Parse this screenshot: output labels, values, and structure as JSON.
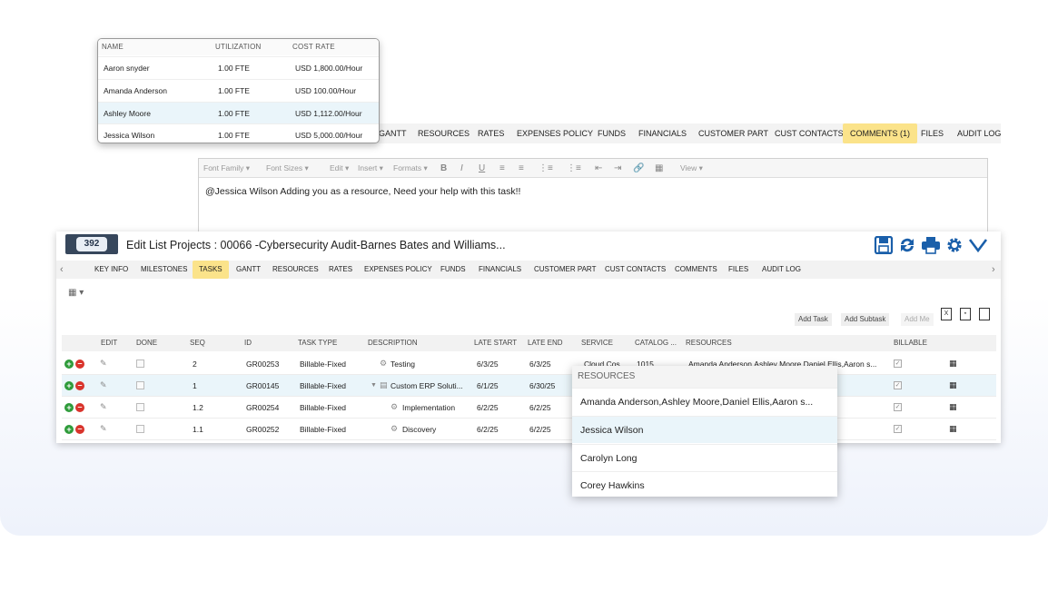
{
  "back_window": {
    "tabs": [
      {
        "label": "GANTT"
      },
      {
        "label": "RESOURCES"
      },
      {
        "label": "RATES"
      },
      {
        "label": "EXPENSES POLICY"
      },
      {
        "label": "FUNDS"
      },
      {
        "label": "FINANCIALS"
      },
      {
        "label": "CUSTOMER PART"
      },
      {
        "label": "CUST CONTACTS"
      },
      {
        "label": "COMMENTS (1)"
      },
      {
        "label": "FILES"
      },
      {
        "label": "AUDIT LOG"
      }
    ],
    "active_tab": "COMMENTS (1)",
    "editor": {
      "toolbar": {
        "font_family": "Font Family",
        "font_sizes": "Font Sizes",
        "edit": "Edit",
        "insert": "Insert",
        "formats": "Formats",
        "view": "View"
      },
      "content": "@Jessica Wilson Adding you as a resource, Need your help with this task!!"
    }
  },
  "rates_popup": {
    "headers": {
      "name": "NAME",
      "utilization": "UTILIZATION",
      "cost_rate": "COST RATE"
    },
    "rows": [
      {
        "name": "Aaron snyder",
        "utilization": "1.00 FTE",
        "cost_rate": "USD 1,800.00/Hour"
      },
      {
        "name": "Amanda Anderson",
        "utilization": "1.00 FTE",
        "cost_rate": "USD 100.00/Hour"
      },
      {
        "name": "Ashley Moore",
        "utilization": "1.00 FTE",
        "cost_rate": "USD 1,112.00/Hour"
      },
      {
        "name": "Jessica Wilson",
        "utilization": "1.00 FTE",
        "cost_rate": "USD 5,000.00/Hour"
      }
    ]
  },
  "main_window": {
    "logo_text": "392",
    "title": "Edit List Projects : 00066 -Cybersecurity Audit-Barnes Bates and Williams...",
    "tabs": [
      {
        "label": "KEY INFO"
      },
      {
        "label": "MILESTONES"
      },
      {
        "label": "TASKS"
      },
      {
        "label": "GANTT"
      },
      {
        "label": "RESOURCES"
      },
      {
        "label": "RATES"
      },
      {
        "label": "EXPENSES POLICY"
      },
      {
        "label": "FUNDS"
      },
      {
        "label": "FINANCIALS"
      },
      {
        "label": "CUSTOMER PART"
      },
      {
        "label": "CUST CONTACTS"
      },
      {
        "label": "COMMENTS"
      },
      {
        "label": "FILES"
      },
      {
        "label": "AUDIT LOG"
      }
    ],
    "active_tab": "TASKS",
    "actions": {
      "add_task": "Add Task",
      "add_subtask": "Add Subtask",
      "add_me": "Add Me"
    },
    "table": {
      "headers": {
        "edit": "EDIT",
        "done": "DONE",
        "seq": "SEQ",
        "id": "ID",
        "task_type": "TASK TYPE",
        "description": "DESCRIPTION",
        "late_start": "LATE START",
        "late_end": "LATE END",
        "service": "SERVICE",
        "catalog": "CATALOG ...",
        "resources": "RESOURCES",
        "billable": "BILLABLE"
      },
      "rows": [
        {
          "seq": "2",
          "id": "GR00253",
          "task_type": "Billable-Fixed",
          "description": "Testing",
          "late_start": "6/3/25",
          "late_end": "6/3/25",
          "service": "Cloud Cos...",
          "catalog": "1015",
          "resources": "Amanda Anderson,Ashley Moore,Daniel Ellis,Aaron s..."
        },
        {
          "seq": "1",
          "id": "GR00145",
          "task_type": "Billable-Fixed",
          "description": "Custom ERP Soluti...",
          "late_start": "6/1/25",
          "late_end": "6/30/25",
          "service": "",
          "catalog": "",
          "resources": ""
        },
        {
          "seq": "1.2",
          "id": "GR00254",
          "task_type": "Billable-Fixed",
          "description": "Implementation",
          "late_start": "6/2/25",
          "late_end": "6/2/25",
          "service": "",
          "catalog": "",
          "resources": ""
        },
        {
          "seq": "1.1",
          "id": "GR00252",
          "task_type": "Billable-Fixed",
          "description": "Discovery",
          "late_start": "6/2/25",
          "late_end": "6/2/25",
          "service": "",
          "catalog": "",
          "resources": ""
        }
      ]
    }
  },
  "resources_dropdown": {
    "header": "RESOURCES",
    "items": [
      {
        "label": "Amanda Anderson,Ashley Moore,Daniel Ellis,Aaron s..."
      },
      {
        "label": "Jessica Wilson"
      },
      {
        "label": "Carolyn Long"
      },
      {
        "label": "Corey Hawkins"
      }
    ],
    "highlighted": "Jessica Wilson"
  },
  "colors": {
    "accent_tab": "#fbe38a",
    "toolbar_icon": "#1a5faa",
    "row_highlight": "#eaf5fa"
  }
}
